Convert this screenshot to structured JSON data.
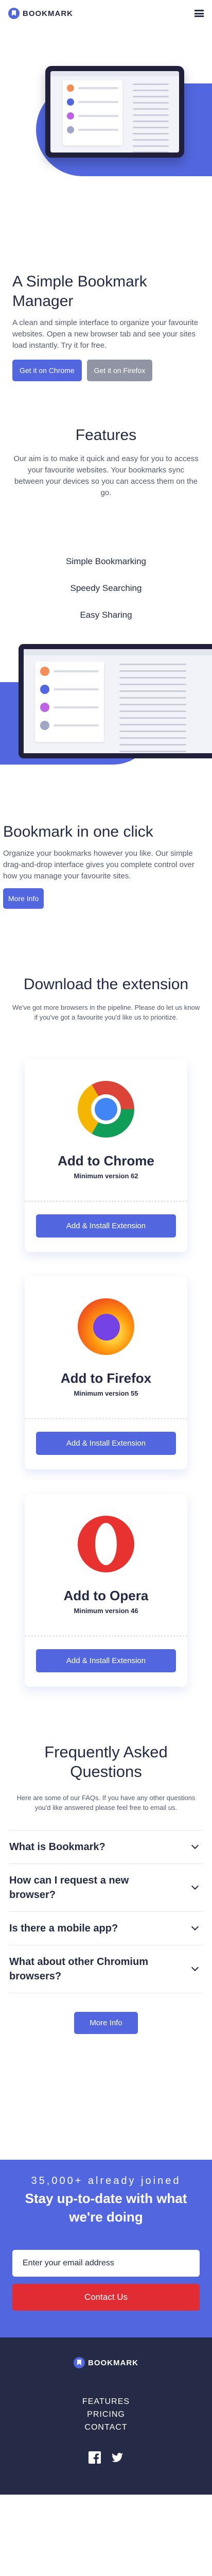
{
  "header": {
    "logo_text": "BOOKMARK",
    "menu_icon": "hamburger-icon"
  },
  "hero": {
    "title": "A Simple Bookmark Manager",
    "description": "A clean and simple interface to organize your favourite websites. Open a new browser tab and see your sites load instantly. Try it for free.",
    "chrome_button": "Get it on Chrome",
    "firefox_button": "Get it on Firefox"
  },
  "features": {
    "title": "Features",
    "description": "Our aim is to make it quick and easy for you to access your favourite websites. Your bookmarks sync between your devices so you can access them on the go.",
    "tabs": [
      "Simple Bookmarking",
      "Speedy Searching",
      "Easy Sharing"
    ],
    "panel_title": "Bookmark in one click",
    "panel_description": "Organize your bookmarks however you like. Our simple drag-and-drop interface gives you complete control over how you manage your favourite sites.",
    "panel_button": "More Info"
  },
  "download": {
    "title": "Download the extension",
    "description": "We've got more browsers in the pipeline. Please do let us know if you've got a favourite you'd like us to prioritize.",
    "browsers": [
      {
        "name": "Add to Chrome",
        "version": "Minimum version 62",
        "button": "Add & Install Extension",
        "icon": "chrome-icon"
      },
      {
        "name": "Add to Firefox",
        "version": "Minimum version 55",
        "button": "Add & Install Extension",
        "icon": "firefox-icon"
      },
      {
        "name": "Add to Opera",
        "version": "Minimum version 46",
        "button": "Add & Install Extension",
        "icon": "opera-icon"
      }
    ]
  },
  "faq": {
    "title": "Frequently Asked Questions",
    "description": "Here are some of our FAQs. If you have any other questions you'd like answered please feel free to email us.",
    "questions": [
      "What is Bookmark?",
      "How can I request a new browser?",
      "Is there a mobile app?",
      "What about other Chromium browsers?"
    ],
    "more_button": "More Info"
  },
  "cta": {
    "joined": "35,000+ already joined",
    "title": "Stay up-to-date with what we're doing",
    "input_placeholder": "Enter your email address",
    "button": "Contact Us"
  },
  "footer": {
    "logo_text": "BOOKMARK",
    "links": [
      "FEATURES",
      "PRICING",
      "CONTACT"
    ],
    "social": [
      "facebook-icon",
      "twitter-icon"
    ]
  },
  "colors": {
    "primary": "#5267df",
    "accent_red": "#e12c34",
    "dark": "#242a45",
    "grey": "#9194a2"
  }
}
